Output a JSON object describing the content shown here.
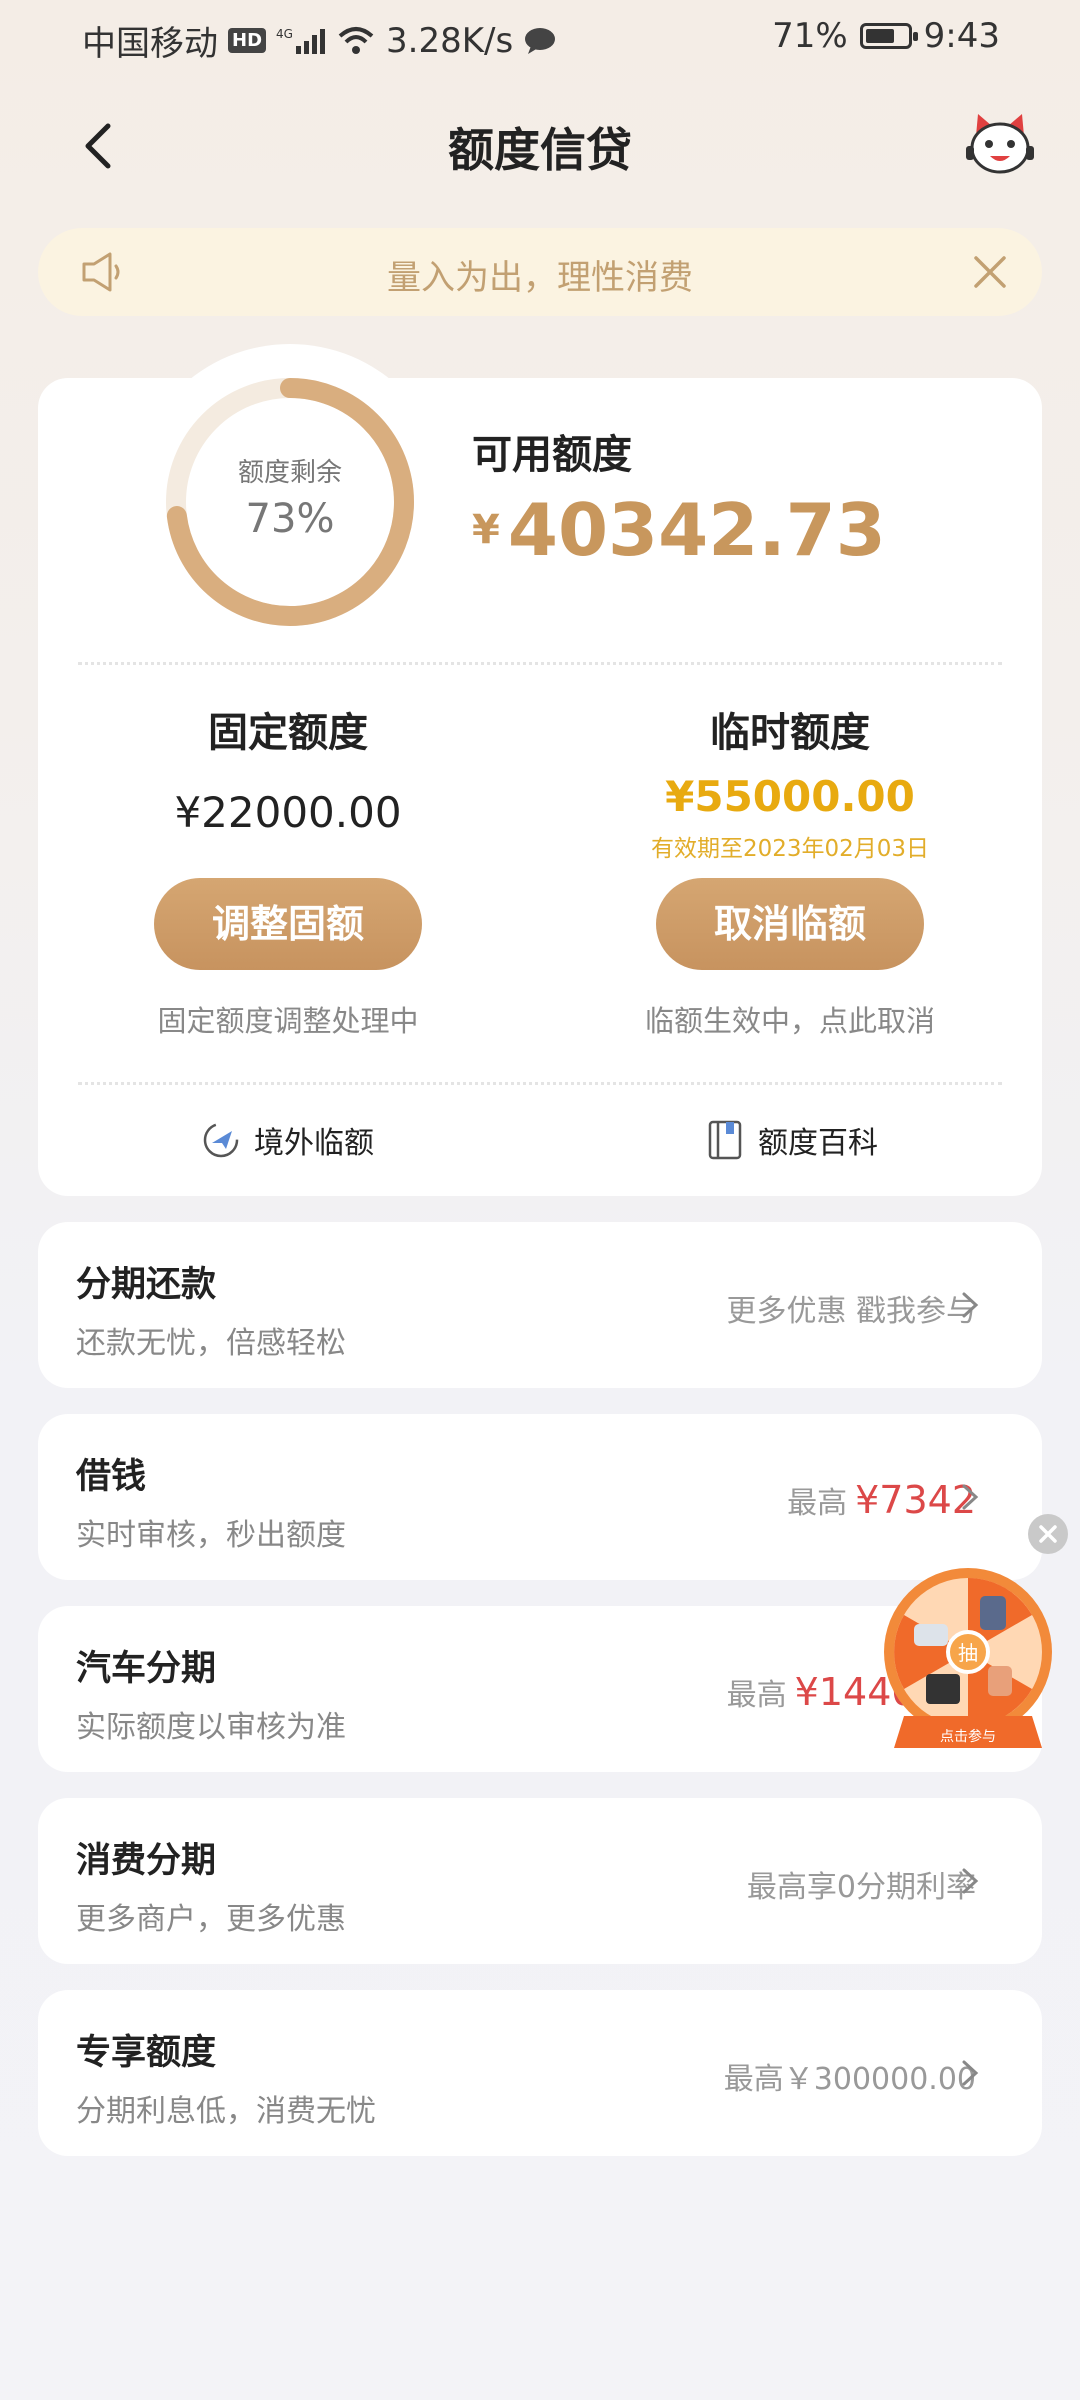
{
  "status_bar": {
    "carrier": "中国移动",
    "hd": "HD",
    "network": "4G",
    "speed": "3.28K/s",
    "battery_pct": "71%",
    "battery_level": 0.71,
    "time": "9:43"
  },
  "nav": {
    "title": "额度信贷",
    "back_icon": "chevron-left-icon",
    "mascot_icon": "mascot-icon"
  },
  "notice": {
    "text": "量入为出，理性消费",
    "icon": "speaker-icon"
  },
  "credit": {
    "ring_label": "额度剩余",
    "ring_pct": "73%",
    "ring_value": 0.73,
    "available_label": "可用额度",
    "currency": "¥",
    "available_amount": "40342.73",
    "fixed": {
      "title": "固定额度",
      "amount": "¥22000.00",
      "button": "调整固额",
      "note": "固定额度调整处理中"
    },
    "temp": {
      "title": "临时额度",
      "amount": "¥55000.00",
      "valid": "有效期至2023年02月03日",
      "button": "取消临额",
      "note": "临额生效中，点此取消"
    },
    "links": {
      "overseas": "境外临额",
      "encyclopedia": "额度百科"
    }
  },
  "rows": [
    {
      "title": "分期还款",
      "sub": "还款无忧，倍感轻松",
      "right_text": "更多优惠 戳我参与",
      "highlight": ""
    },
    {
      "title": "借钱",
      "sub": "实时审核，秒出额度",
      "right_text": "最高",
      "highlight": "¥7342"
    },
    {
      "title": "汽车分期",
      "sub": "实际额度以审核为准",
      "right_text": "最高",
      "highlight": "¥144000."
    },
    {
      "title": "消费分期",
      "sub": "更多商户，更多优惠",
      "right_text": "最高享0分期利率",
      "highlight": ""
    },
    {
      "title": "专享额度",
      "sub": "分期利息低，消费无忧",
      "right_text": "最高￥300000.00",
      "highlight": ""
    }
  ],
  "lucky_wheel": {
    "center": "抽",
    "banner": "点击参与"
  },
  "colors": {
    "accent": "#c8975d",
    "temp": "#e8aa10",
    "highlight": "#dc4848"
  }
}
